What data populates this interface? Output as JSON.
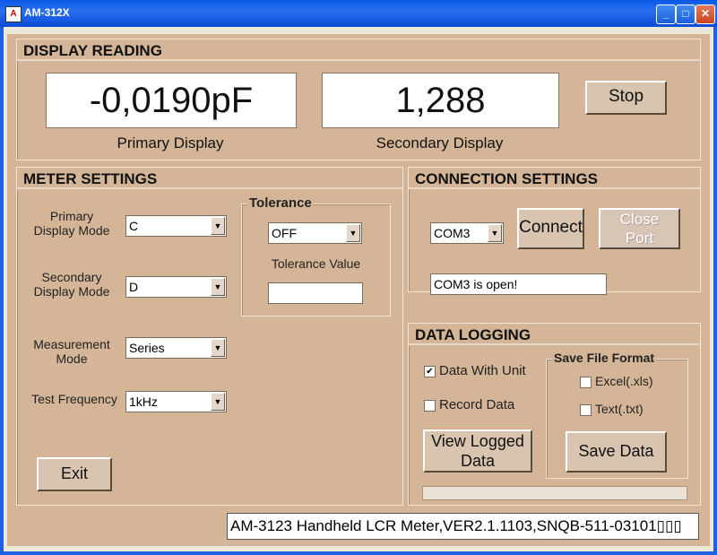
{
  "window": {
    "title": "AM-312X",
    "icon": "app-logo-icon"
  },
  "display": {
    "title": "DISPLAY READING",
    "primary_value": "-0,0190pF",
    "secondary_value": "1,288",
    "primary_caption": "Primary Display",
    "secondary_caption": "Secondary Display",
    "stop_label": "Stop"
  },
  "meter": {
    "title": "METER SETTINGS",
    "primary_mode_label": "Primary\nDisplay Mode",
    "primary_mode_value": "C",
    "secondary_mode_label": "Secondary\nDisplay Mode",
    "secondary_mode_value": "D",
    "measurement_label": "Measurement\nMode",
    "measurement_value": "Series",
    "frequency_label": "Test Frequency",
    "frequency_value": "1kHz",
    "tolerance_title": "Tolerance",
    "tolerance_value": "OFF",
    "tolerance_value_label": "Tolerance Value",
    "tolerance_input": "",
    "exit_label": "Exit"
  },
  "connection": {
    "title": "CONNECTION SETTINGS",
    "port_value": "COM3",
    "connect_label": "Connect",
    "close_label": "Close\nPort",
    "status_text": "COM3 is open!"
  },
  "logging": {
    "title": "DATA LOGGING",
    "data_with_unit": "Data With Unit",
    "data_with_unit_checked": true,
    "record_data": "Record Data",
    "record_data_checked": false,
    "view_logged_label": "View Logged\nData",
    "format_title": "Save File Format",
    "excel_label": "Excel(.xls)",
    "text_label": "Text(.txt)",
    "save_label": "Save Data"
  },
  "status_bar": "AM-3123 Handheld LCR Meter,VER2.1.1103,SNQB-511-03101▯▯▯"
}
